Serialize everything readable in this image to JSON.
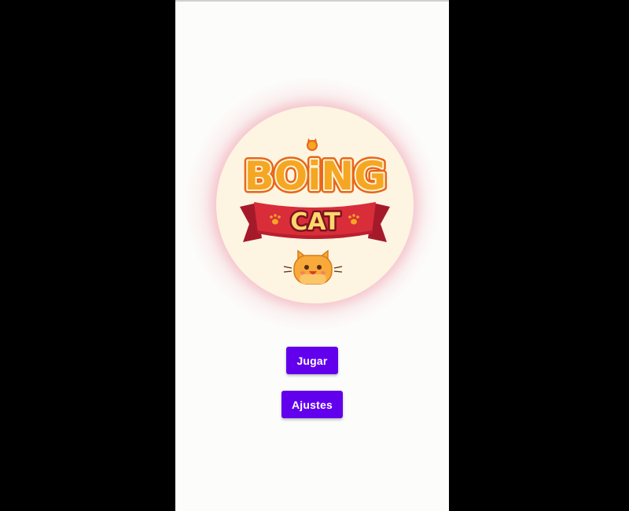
{
  "logo": {
    "word_top": "BOiNG",
    "word_banner": "CAT",
    "colors": {
      "circle": "#fdf5e1",
      "title_orange": "#f5a623",
      "title_outline": "#e8661a",
      "banner_red": "#d92d3a",
      "banner_dark": "#a51a2a",
      "cat_fur": "#f7a93a"
    },
    "icons": [
      "paw-icon",
      "cat-mascot-icon"
    ]
  },
  "menu": {
    "play_label": "Jugar",
    "settings_label": "Ajustes",
    "button_color": "#6200ee"
  }
}
